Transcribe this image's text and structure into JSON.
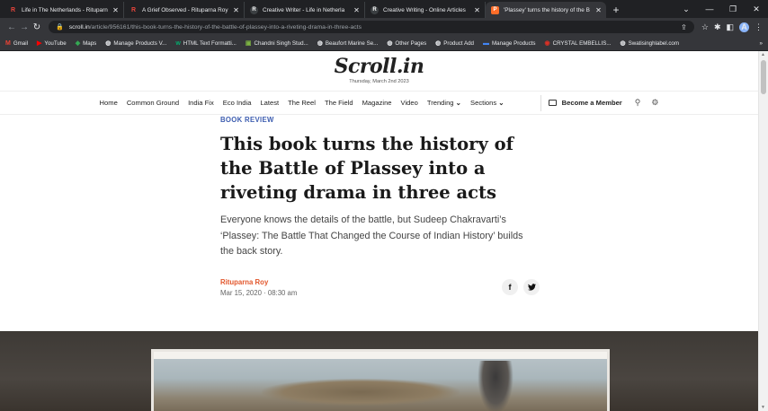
{
  "browser": {
    "tabs": [
      {
        "title": "Life in The Netherlands - Rituparn",
        "favicon": "R",
        "fav_class": "red",
        "active": false
      },
      {
        "title": "A Grief Observed - Rituparna Roy",
        "favicon": "R",
        "fav_class": "red",
        "active": false
      },
      {
        "title": "Creative Writer - Life in Netherla",
        "favicon": "R",
        "fav_class": "scroll",
        "active": false
      },
      {
        "title": "Creative Writing - Online Articles",
        "favicon": "R",
        "fav_class": "scroll",
        "active": false
      },
      {
        "title": "'Plassey' turns the history of the B",
        "favicon": "P",
        "fav_class": "orange",
        "active": true
      }
    ],
    "new_tab_glyph": "+",
    "url_host": "scroll.in",
    "url_path": "/article/956161/this-book-turns-the-history-of-the-battle-of-plassey-into-a-riveting-drama-in-three-acts",
    "profile_initial": "A",
    "bookmarks": [
      {
        "label": "Gmail",
        "icon": "M",
        "color": "#ea4335"
      },
      {
        "label": "YouTube",
        "icon": "▶",
        "color": "#ff0000"
      },
      {
        "label": "Maps",
        "icon": "◆",
        "color": "#34a853"
      },
      {
        "label": "Manage Products V...",
        "icon": "◍",
        "color": "#e8eaed"
      },
      {
        "label": "HTML Text Formatti...",
        "icon": "w",
        "color": "#04aa6d"
      },
      {
        "label": "Chandni Singh Stud...",
        "icon": "▣",
        "color": "#7cb342"
      },
      {
        "label": "Beaufort Marine Se...",
        "icon": "◍",
        "color": "#e8eaed"
      },
      {
        "label": "Other Pages",
        "icon": "◍",
        "color": "#e8eaed"
      },
      {
        "label": "Product Add",
        "icon": "◍",
        "color": "#e8eaed"
      },
      {
        "label": "Manage Products",
        "icon": "▬",
        "color": "#4285f4"
      },
      {
        "label": "CRYSTAL EMBELLIS...",
        "icon": "◉",
        "color": "#d93025"
      },
      {
        "label": "Swatisinghlabel.com",
        "icon": "◍",
        "color": "#e8eaed"
      }
    ],
    "bookmarks_overflow": "»"
  },
  "site": {
    "logo": "Scroll.in",
    "date": "Thursday, March 2nd 2023",
    "nav": [
      "Home",
      "Common Ground",
      "India Fix",
      "Eco India",
      "Latest",
      "The Reel",
      "The Field",
      "Magazine",
      "Video",
      "Trending",
      "Sections"
    ],
    "member_label": "Become a Member"
  },
  "article": {
    "category": "BOOK REVIEW",
    "headline": "This book turns the history of the Battle of Plassey into a riveting drama in three acts",
    "dek": "Everyone knows the details of the battle, but Sudeep Chakravarti’s ‘Plassey: The Battle That Changed the Course of Indian History’ builds the back story.",
    "author": "Rituparna Roy",
    "published": "Mar 15, 2020 · 08:30 am",
    "share": [
      "f",
      "t"
    ]
  }
}
